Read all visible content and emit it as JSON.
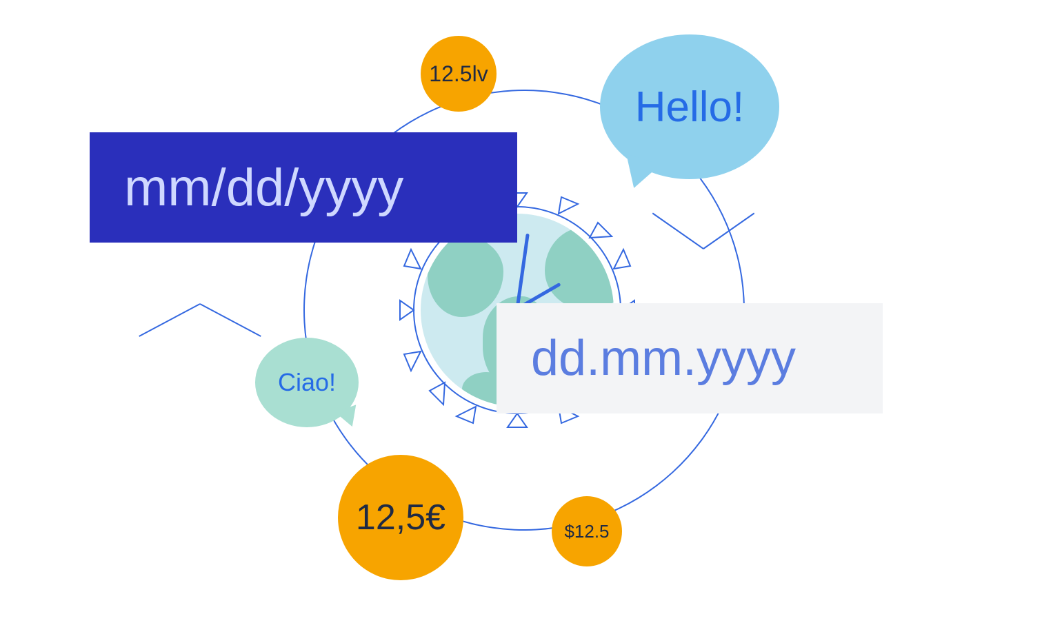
{
  "diagram": {
    "date_formats": {
      "us": "mm/dd/yyyy",
      "eu": "dd.mm.yyyy"
    },
    "greetings": {
      "english": "Hello!",
      "italian": "Ciao!"
    },
    "currency": {
      "lev": "12.5lv",
      "euro": "12,5€",
      "usd": "$12.5"
    },
    "colors": {
      "accent_blue": "#3468e0",
      "box_indigo": "#2a2fbb",
      "box_light": "#f3f4f6",
      "coin_orange": "#f7a400",
      "bubble_sky": "#8fd1ed",
      "bubble_teal": "#a9dfd2",
      "globe_water": "#cdeaf0",
      "globe_land": "#8fd0c3"
    }
  }
}
